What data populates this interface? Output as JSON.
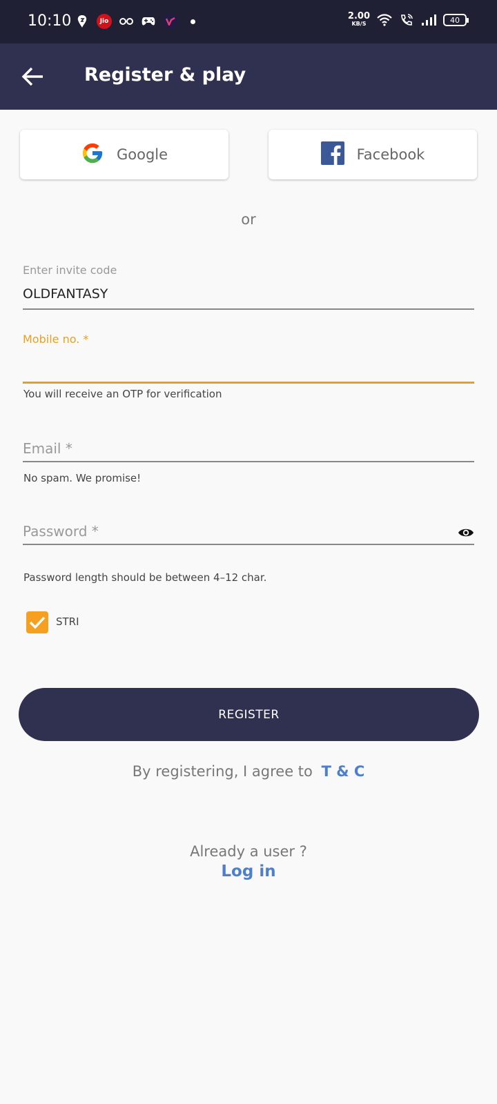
{
  "status_bar": {
    "time": "10:10",
    "net_speed_value": "2.00",
    "net_speed_unit": "KB/S",
    "battery": "40",
    "jio_label": "Jio"
  },
  "app_bar": {
    "title": "Register & play"
  },
  "social": {
    "google_label": "Google",
    "facebook_label": "Facebook"
  },
  "divider_text": "or",
  "invite": {
    "label": "Enter invite code",
    "value": "OLDFANTASY"
  },
  "mobile": {
    "label": "Mobile no. *",
    "helper": "You will receive an OTP for verification"
  },
  "email": {
    "placeholder": "Email *",
    "helper": "No spam. We promise!"
  },
  "password": {
    "placeholder": "Password *",
    "helper": "Password length should be between 4–12 char."
  },
  "checkbox": {
    "label": "STRI",
    "checked": true
  },
  "register_button": "REGISTER",
  "agree": {
    "text": "By registering, I agree to",
    "link": "T & C"
  },
  "login": {
    "prompt": "Already a user ?",
    "link": "Log in"
  },
  "colors": {
    "accent": "#f5a021",
    "primary": "#303050",
    "link": "#4d7fcc"
  }
}
